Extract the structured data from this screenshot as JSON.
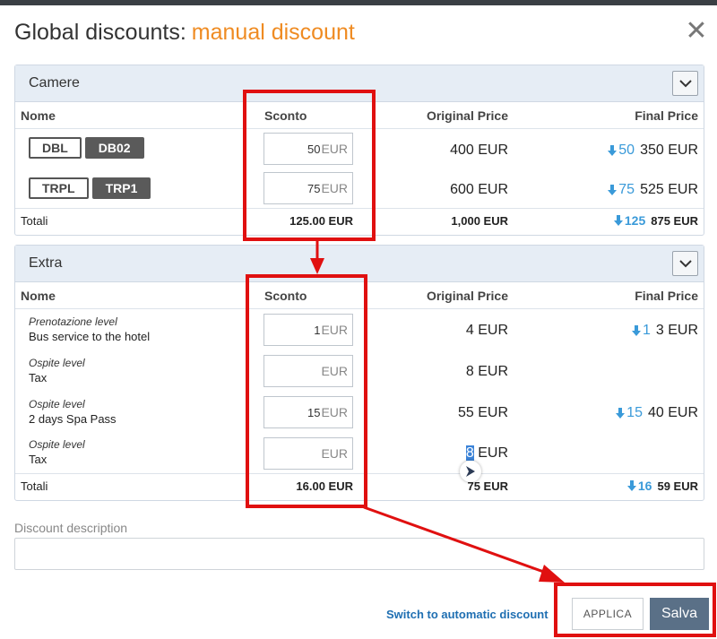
{
  "header": {
    "title": "Global discounts:",
    "accent": "manual discount",
    "close_glyph": "✕"
  },
  "columns": {
    "name": "Nome",
    "sconto": "Sconto",
    "original": "Original Price",
    "final": "Final Price"
  },
  "camere": {
    "title": "Camere",
    "rows": [
      {
        "tag1": "DBL",
        "tag2": "DB02",
        "discount": "50",
        "currency": "EUR",
        "original": "400 EUR",
        "final_discount": "50",
        "final_price": "350 EUR"
      },
      {
        "tag1": "TRPL",
        "tag2": "TRP1",
        "discount": "75",
        "currency": "EUR",
        "original": "600 EUR",
        "final_discount": "75",
        "final_price": "525 EUR"
      }
    ],
    "total": {
      "label": "Totali",
      "sconto": "125.00 EUR",
      "original": "1,000 EUR",
      "final_discount": "125",
      "final_price": "875 EUR"
    }
  },
  "extra": {
    "title": "Extra",
    "rows": [
      {
        "level": "Prenotazione level",
        "name": "Bus service to the hotel",
        "discount": "1",
        "currency": "EUR",
        "original": "4 EUR",
        "final_discount": "1",
        "final_price": "3 EUR"
      },
      {
        "level": "Ospite level",
        "name": "Tax",
        "discount": "",
        "currency": "EUR",
        "original": "8 EUR",
        "final_discount": "",
        "final_price": ""
      },
      {
        "level": "Ospite level",
        "name": "2 days Spa Pass",
        "discount": "15",
        "currency": "EUR",
        "original": "55 EUR",
        "final_discount": "15",
        "final_price": "40 EUR"
      },
      {
        "level": "Ospite level",
        "name": "Tax",
        "discount": "",
        "currency": "EUR",
        "original_sel": "8",
        "original_unit": "EUR",
        "final_discount": "",
        "final_price": ""
      }
    ],
    "total": {
      "label": "Totali",
      "sconto": "16.00 EUR",
      "original": "75 EUR",
      "final_discount": "16",
      "final_price": "59 EUR"
    }
  },
  "description": {
    "label": "Discount description",
    "value": ""
  },
  "footer": {
    "switch_link": "Switch to automatic discount",
    "applica": "APPLICA",
    "salva": "Salva"
  },
  "colors": {
    "accent": "#ef8b22",
    "discount_blue": "#3a9ad9",
    "annotation_red": "#e01010",
    "save_button": "#5a7087"
  }
}
